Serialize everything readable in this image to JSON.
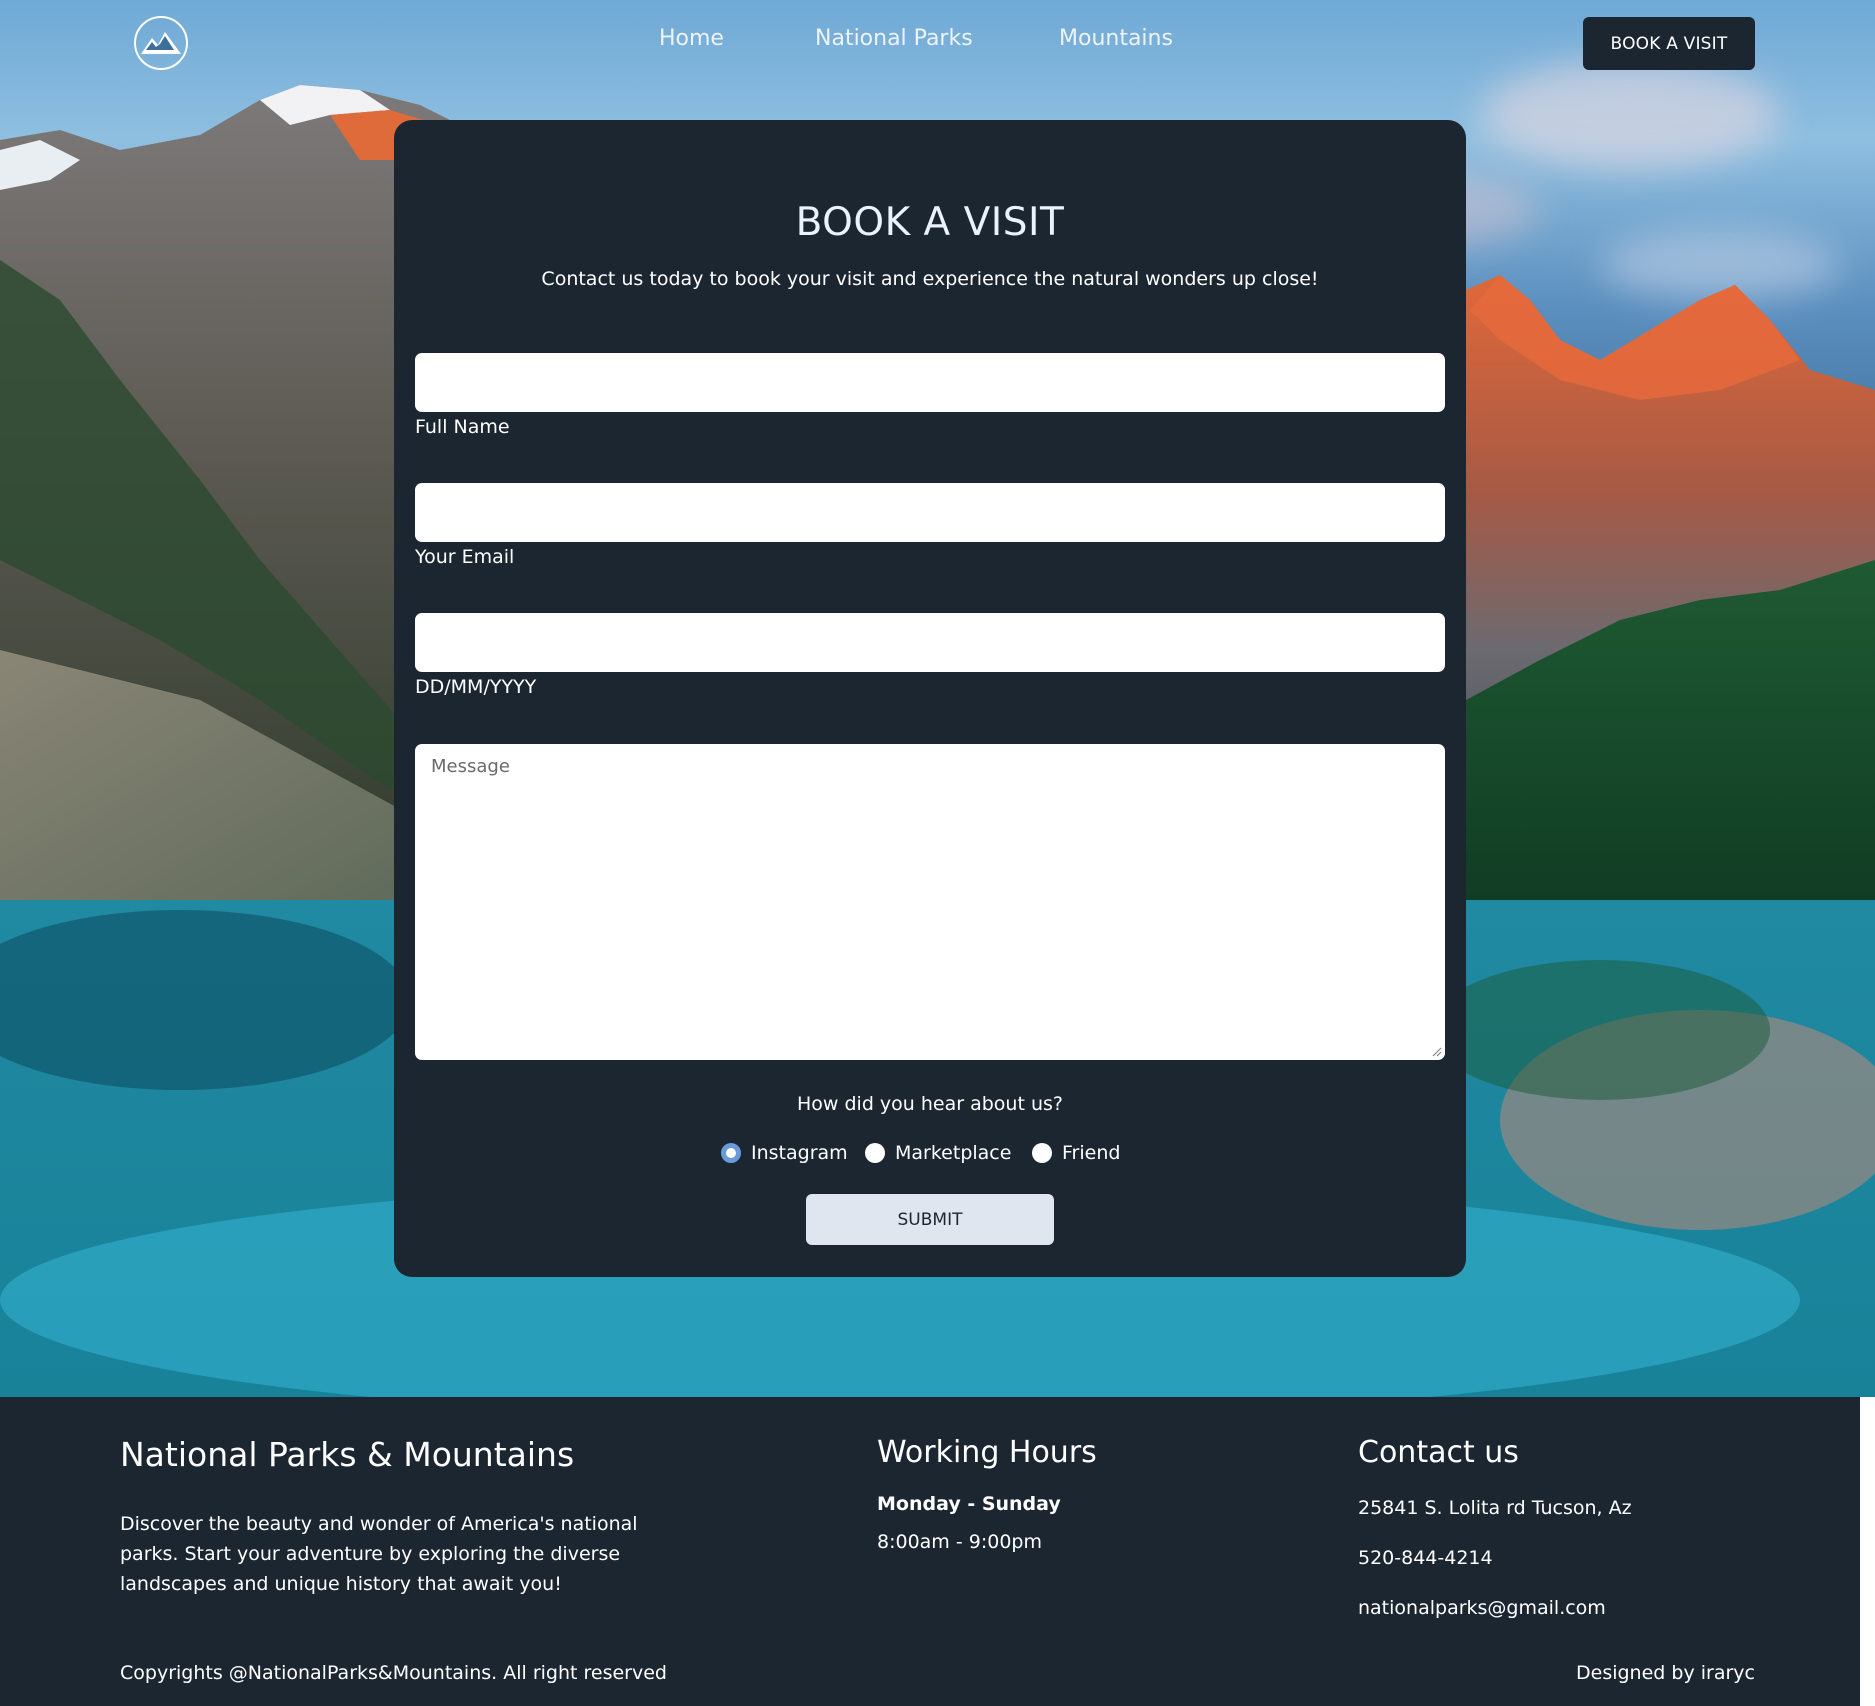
{
  "nav": {
    "logo": "mountain-logo",
    "links": [
      "Home",
      "National Parks",
      "Mountains"
    ],
    "cta": "BOOK A VISIT"
  },
  "booking": {
    "title": "BOOK A VISIT",
    "subtitle": "Contact us today to book your visit and experience the natural wonders up close!",
    "fields": [
      {
        "label": "Full Name",
        "value": ""
      },
      {
        "label": "Your Email",
        "value": ""
      },
      {
        "label": "DD/MM/YYYY",
        "value": ""
      }
    ],
    "message_placeholder": "Message",
    "question": "How did you hear about us?",
    "options": [
      {
        "label": "Instagram",
        "selected": true
      },
      {
        "label": "Marketplace",
        "selected": false
      },
      {
        "label": "Friend",
        "selected": false
      }
    ],
    "submit": "SUBMIT"
  },
  "footer": {
    "about_title": "National Parks & Mountains",
    "about_text": "Discover the beauty and wonder of America's national parks. Start your adventure by exploring the diverse landscapes and unique history that await you!",
    "hours_title": "Working Hours",
    "hours_days": "Monday - Sunday",
    "hours_time": "8:00am - 9:00pm",
    "contact_title": "Contact us",
    "address": "25841 S. Lolita rd Tucson, Az",
    "phone": "520-844-4214",
    "email": "nationalparks@gmail.com",
    "copyright": "Copyrights @NationalParks&Mountains. All right reserved",
    "credit": "Designed by iraryc"
  },
  "colors": {
    "panel": "#1b2631",
    "radio_selected": "#6a9bd8",
    "submit_bg": "#dfe6ef"
  }
}
